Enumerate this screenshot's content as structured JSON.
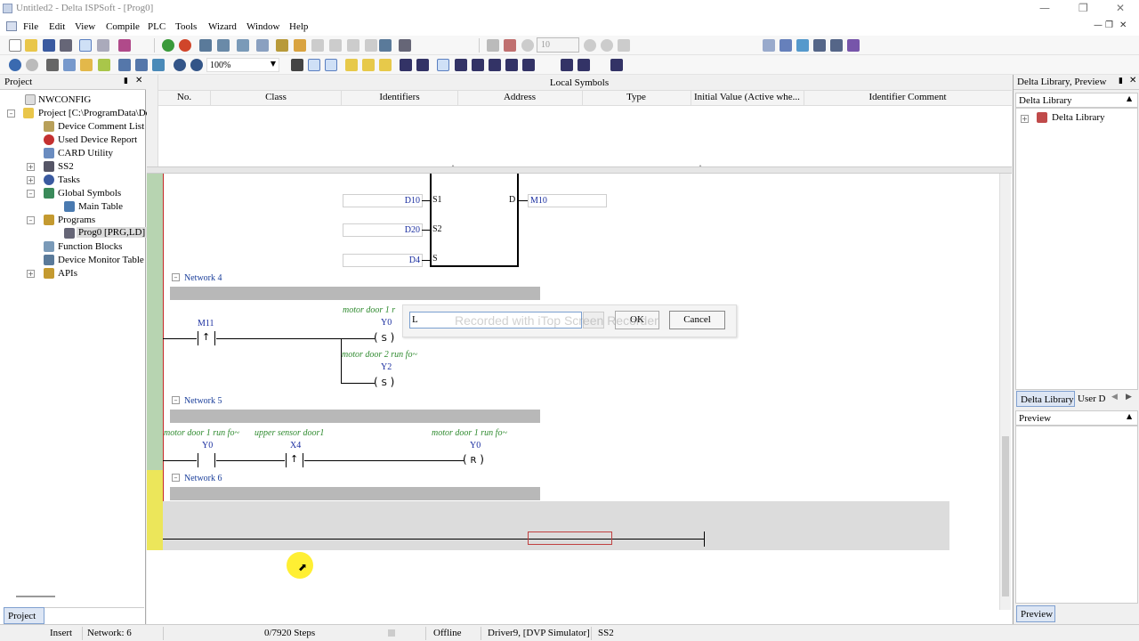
{
  "window": {
    "title": "Untitled2 - Delta ISPSoft - [Prog0]"
  },
  "menu": [
    "File",
    "Edit",
    "View",
    "Compile",
    "PLC",
    "Tools",
    "Wizard",
    "Window",
    "Help"
  ],
  "toolbar": {
    "zoom": "100%",
    "step": "10"
  },
  "project_panel": {
    "title": "Project",
    "tab": "Project",
    "items": [
      {
        "label": "NWCONFIG"
      },
      {
        "label": "Project [C:\\ProgramData\\Delt"
      },
      {
        "label": "Device Comment List"
      },
      {
        "label": "Used Device Report"
      },
      {
        "label": "CARD Utility"
      },
      {
        "label": "SS2"
      },
      {
        "label": "Tasks"
      },
      {
        "label": "Global Symbols"
      },
      {
        "label": "Main Table"
      },
      {
        "label": "Programs"
      },
      {
        "label": "Prog0 [PRG,LD]"
      },
      {
        "label": "Function Blocks"
      },
      {
        "label": "Device Monitor Table"
      },
      {
        "label": "APIs"
      }
    ]
  },
  "local_symbols": {
    "title": "Local Symbols",
    "columns": [
      "No.",
      "Class",
      "Identifiers",
      "Address",
      "Type",
      "Initial Value (Active whe...",
      "Identifier Comment"
    ]
  },
  "ladder": {
    "block_inputs": {
      "s1": "D10",
      "s2": "D20",
      "s": "D4"
    },
    "block_output": {
      "pin": "D",
      "var": "M10"
    },
    "pins": {
      "s1": "S1",
      "s2": "S2",
      "s": "S"
    },
    "net4": {
      "label": "Network 4",
      "contact_var": "M11",
      "coil1_comment": "motor door 1 r",
      "coil1_var": "Y0",
      "coil1_type": "S",
      "coil2_comment": "motor door 2 run fo~",
      "coil2_var": "Y2",
      "coil2_type": "S"
    },
    "net5": {
      "label": "Network 5",
      "c1_comment": "motor door 1 run fo~",
      "c1_var": "Y0",
      "c2_comment": "upper sensor door1",
      "c2_var": "X4",
      "coil_comment": "motor door 1 run fo~",
      "coil_var": "Y0",
      "coil_type": "R"
    },
    "net6": {
      "label": "Network 6"
    }
  },
  "dialog": {
    "input_value": "L",
    "ok": "OK",
    "cancel": "Cancel",
    "watermark": "Recorded with iTop Screen Recorder"
  },
  "library_panel": {
    "title": "Delta Library, Preview",
    "subheader": "Delta Library",
    "tree_item": "Delta Library",
    "tabs": [
      "Delta Library",
      "User D"
    ],
    "preview_title": "Preview",
    "preview_tab": "Preview"
  },
  "status": {
    "mode": "Insert",
    "network": "Network: 6",
    "steps": "0/7920 Steps",
    "conn": "Offline",
    "driver": "Driver9, [DVP Simulator]",
    "station": "SS2"
  }
}
